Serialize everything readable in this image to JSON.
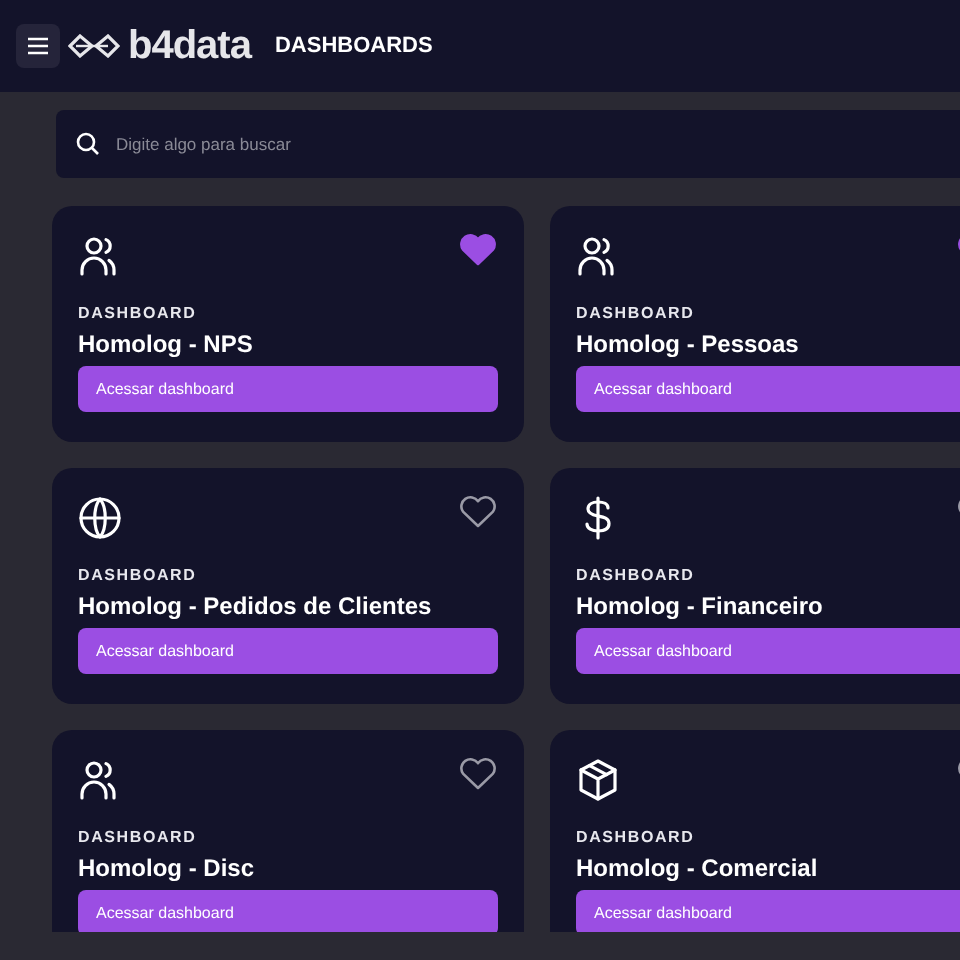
{
  "header": {
    "logo": "b4data",
    "title": "DASHBOARDS"
  },
  "search": {
    "placeholder": "Digite algo para buscar"
  },
  "cards": [
    {
      "kind": "users",
      "favorite": true,
      "label": "DASHBOARD",
      "title": "Homolog - NPS",
      "button": "Acessar dashboard"
    },
    {
      "kind": "users",
      "favorite": true,
      "label": "DASHBOARD",
      "title": "Homolog - Pessoas",
      "button": "Acessar dashboard"
    },
    {
      "kind": "globe",
      "favorite": false,
      "label": "DASHBOARD",
      "title": "Homolog - Pedidos de Clientes",
      "button": "Acessar dashboard"
    },
    {
      "kind": "dollar",
      "favorite": false,
      "label": "DASHBOARD",
      "title": "Homolog - Financeiro",
      "button": "Acessar dashboard"
    },
    {
      "kind": "users",
      "favorite": false,
      "label": "DASHBOARD",
      "title": "Homolog - Disc",
      "button": "Acessar dashboard"
    },
    {
      "kind": "box",
      "favorite": false,
      "label": "DASHBOARD",
      "title": "Homolog - Comercial",
      "button": "Acessar dashboard"
    }
  ]
}
